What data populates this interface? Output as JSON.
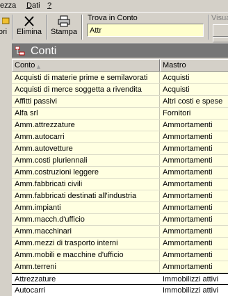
{
  "menu": {
    "items": [
      {
        "pre": "",
        "ul": "",
        "post": "tezza"
      },
      {
        "pre": "",
        "ul": "D",
        "post": "ati"
      },
      {
        "pre": "",
        "ul": "?",
        "post": ""
      }
    ]
  },
  "toolbar": {
    "nuovo_label": "ori",
    "elimina_label": "Elimina",
    "stampa_label": "Stampa",
    "search_label": "Trova in Conto",
    "search_value": "Attr",
    "visual_label": "Visua"
  },
  "panel": {
    "title": "Conti"
  },
  "grid": {
    "columns": [
      "Conto",
      "Mastro"
    ],
    "sort_indicator": "▲",
    "rows": [
      {
        "conto": "Acquisti di materie prime e semilavorati",
        "mastro": "Acquisti"
      },
      {
        "conto": "Acquisti di merce soggetta a rivendita",
        "mastro": "Acquisti"
      },
      {
        "conto": "Affitti passivi",
        "mastro": "Altri costi e spese"
      },
      {
        "conto": "Alfa srl",
        "mastro": "Fornitori"
      },
      {
        "conto": "Amm.attrezzature",
        "mastro": "Ammortamenti"
      },
      {
        "conto": "Amm.autocarri",
        "mastro": "Ammortamenti"
      },
      {
        "conto": "Amm.autovetture",
        "mastro": "Ammortamenti"
      },
      {
        "conto": "Amm.costi pluriennali",
        "mastro": "Ammortamenti"
      },
      {
        "conto": "Amm.costruzioni leggere",
        "mastro": "Ammortamenti"
      },
      {
        "conto": "Amm.fabbricati civili",
        "mastro": "Ammortamenti"
      },
      {
        "conto": "Amm.fabbricati destinati all'industria",
        "mastro": "Ammortamenti"
      },
      {
        "conto": "Amm.impianti",
        "mastro": "Ammortamenti"
      },
      {
        "conto": "Amm.macch.d'ufficio",
        "mastro": "Ammortamenti"
      },
      {
        "conto": "Amm.macchinari",
        "mastro": "Ammortamenti"
      },
      {
        "conto": "Amm.mezzi di trasporto interni",
        "mastro": "Ammortamenti"
      },
      {
        "conto": "Amm.mobili e macchine d'ufficio",
        "mastro": "Ammortamenti"
      },
      {
        "conto": "Amm.terreni",
        "mastro": "Ammortamenti"
      },
      {
        "conto": "Attrezzature",
        "mastro": "Immobilizzi attivi"
      },
      {
        "conto": "Autocarri",
        "mastro": "Immobilizzi attivi"
      }
    ],
    "selected_row": 17
  }
}
